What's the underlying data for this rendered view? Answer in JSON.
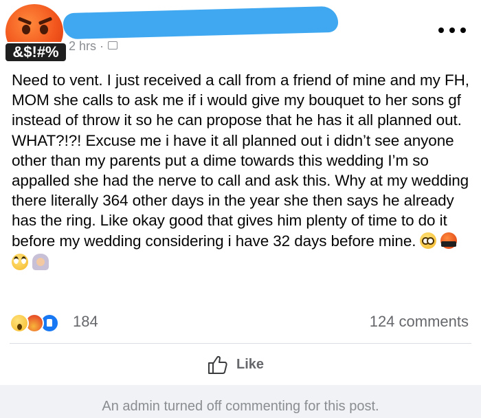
{
  "post": {
    "avatar_badge": "&$!#%",
    "timestamp": "2 hrs ·",
    "body": "Need to vent. I just received a call from a friend of mine and my FH, MOM she calls to ask me if i would give my bouquet to her sons gf instead of throw it so he can propose that he has it all planned out. WHAT?!?! Excuse me i have it all planned out i didn’t see anyone other than my parents put a dime towards this wedding I’m so appalled she had the nerve to call and ask this. Why at my wedding there literally 364 other days in the year she then says he already has the ring. Like okay good that gives him plenty of time to do it before my wedding considering i have 32 days before mine.",
    "trailing_emojis_line1": [
      "flushed-face",
      "cussing-face"
    ],
    "trailing_emojis_line2": [
      "eye-roll-face",
      "woman-facepalming"
    ]
  },
  "engagement": {
    "reaction_types": [
      "wow",
      "angry",
      "like"
    ],
    "reaction_count": "184",
    "comment_count": "124 comments"
  },
  "actions": {
    "like_label": "Like"
  },
  "footer": {
    "comments_notice": "An admin turned off commenting for this post."
  },
  "colors": {
    "redaction": "#3fa8f0",
    "like_blue": "#1877f2",
    "secondary_text": "#65676b",
    "footer_bg": "#f0f2f5"
  }
}
